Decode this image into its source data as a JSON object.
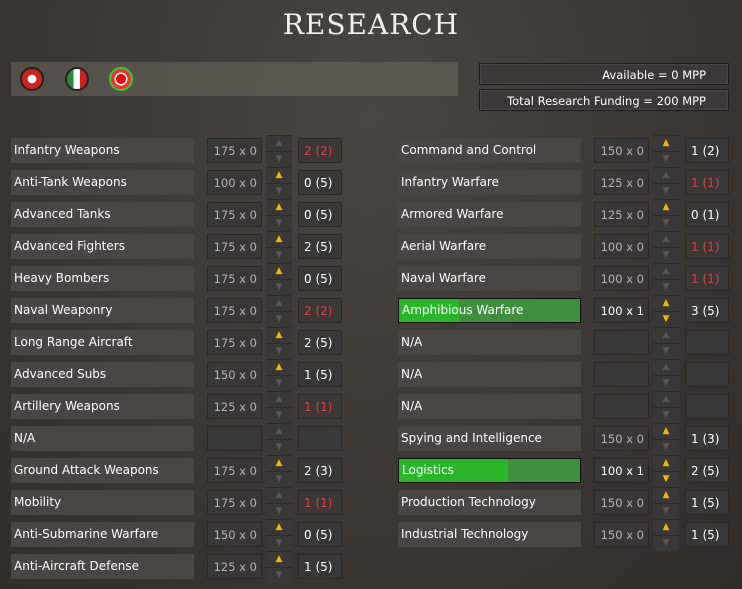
{
  "title": "RESEARCH",
  "funding": {
    "available": "Available =  0 MPP",
    "total": "Total Research Funding =  200 MPP"
  },
  "colors": {
    "accent": "#f5b800",
    "progress": "#2bb52b",
    "maxed": "#e04040"
  },
  "left": [
    {
      "name": "Infantry Weapons",
      "cost": "175 x 0",
      "level": "2 (2)",
      "up": false,
      "down": false,
      "maxed": true
    },
    {
      "name": "Anti-Tank Weapons",
      "cost": "100 x 0",
      "level": "0 (5)",
      "up": true,
      "down": false
    },
    {
      "name": "Advanced Tanks",
      "cost": "175 x 0",
      "level": "0 (5)",
      "up": true,
      "down": false
    },
    {
      "name": "Advanced Fighters",
      "cost": "175 x 0",
      "level": "2 (5)",
      "up": true,
      "down": false
    },
    {
      "name": "Heavy Bombers",
      "cost": "175 x 0",
      "level": "0 (5)",
      "up": true,
      "down": false
    },
    {
      "name": "Naval Weaponry",
      "cost": "175 x 0",
      "level": "2 (2)",
      "up": false,
      "down": false,
      "maxed": true
    },
    {
      "name": "Long Range Aircraft",
      "cost": "175 x 0",
      "level": "2 (5)",
      "up": true,
      "down": false
    },
    {
      "name": "Advanced Subs",
      "cost": "150 x 0",
      "level": "1 (5)",
      "up": true,
      "down": false
    },
    {
      "name": "Artillery Weapons",
      "cost": "125 x 0",
      "level": "1 (1)",
      "up": false,
      "down": false,
      "maxed": true
    },
    {
      "name": "N/A",
      "cost": "",
      "level": "",
      "up": false,
      "down": false
    },
    {
      "name": "Ground Attack Weapons",
      "cost": "175 x 0",
      "level": "2 (3)",
      "up": true,
      "down": false
    },
    {
      "name": "Mobility",
      "cost": "175 x 0",
      "level": "1 (1)",
      "up": false,
      "down": false,
      "maxed": true
    },
    {
      "name": "Anti-Submarine Warfare",
      "cost": "150 x 0",
      "level": "0 (5)",
      "up": true,
      "down": false
    },
    {
      "name": "Anti-Aircraft Defense",
      "cost": "125 x 0",
      "level": "1 (5)",
      "up": true,
      "down": false
    }
  ],
  "right": [
    {
      "name": "Command and Control",
      "cost": "150 x 0",
      "level": "1 (2)",
      "up": true,
      "down": false
    },
    {
      "name": "Infantry Warfare",
      "cost": "125 x 0",
      "level": "1 (1)",
      "up": false,
      "down": false,
      "maxed": true
    },
    {
      "name": "Armored Warfare",
      "cost": "125 x 0",
      "level": "0 (1)",
      "up": true,
      "down": false
    },
    {
      "name": "Aerial Warfare",
      "cost": "100 x 0",
      "level": "1 (1)",
      "up": false,
      "down": false,
      "maxed": true
    },
    {
      "name": "Naval Warfare",
      "cost": "100 x 0",
      "level": "1 (1)",
      "up": false,
      "down": false,
      "maxed": true
    },
    {
      "name": "Amphibious Warfare",
      "cost": "100 x 1",
      "level": "3 (5)",
      "up": true,
      "down": true,
      "progress": 0.33
    },
    {
      "name": "N/A",
      "cost": "",
      "level": "",
      "up": false,
      "down": false
    },
    {
      "name": "N/A",
      "cost": "",
      "level": "",
      "up": false,
      "down": false
    },
    {
      "name": "N/A",
      "cost": "",
      "level": "",
      "up": false,
      "down": false
    },
    {
      "name": "Spying and Intelligence",
      "cost": "150 x 0",
      "level": "1 (3)",
      "up": true,
      "down": false
    },
    {
      "name": "Logistics",
      "cost": "100 x 1",
      "level": "2 (5)",
      "up": true,
      "down": true,
      "progress": 0.6
    },
    {
      "name": "Production Technology",
      "cost": "150 x 0",
      "level": "1 (5)",
      "up": true,
      "down": false
    },
    {
      "name": "Industrial Technology",
      "cost": "150 x 0",
      "level": "1 (5)",
      "up": true,
      "down": false
    }
  ]
}
